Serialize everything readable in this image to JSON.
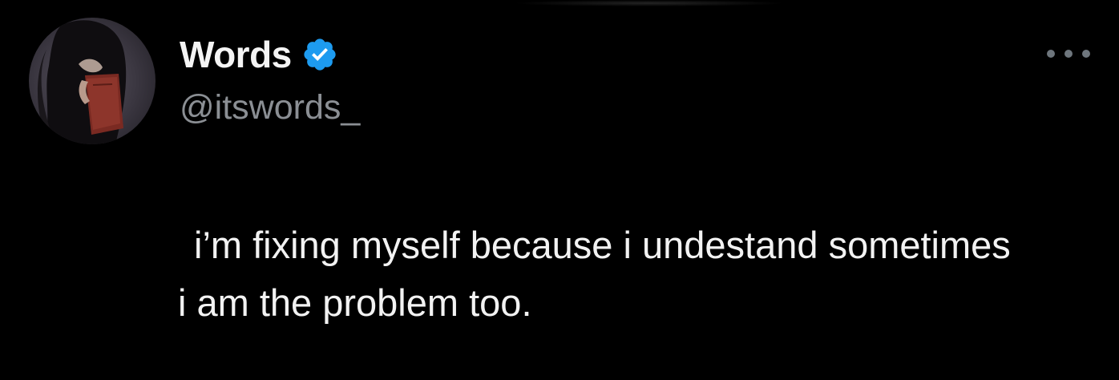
{
  "tweet": {
    "author": {
      "display_name": "Words",
      "handle": "@itswords_",
      "verified": true,
      "avatar_icon": "profile-photo"
    },
    "more_icon": "more-horizontal-icon",
    "text_lines": [
      "i’m fixing myself because i undestand sometimes",
      "i am the problem too."
    ]
  },
  "colors": {
    "background": "#000000",
    "name": "#f4f4f4",
    "handle": "#8b8f94",
    "verified_badge": "#1d9bf0",
    "text": "#f2f2f2",
    "more_dots": "#6e767d"
  }
}
